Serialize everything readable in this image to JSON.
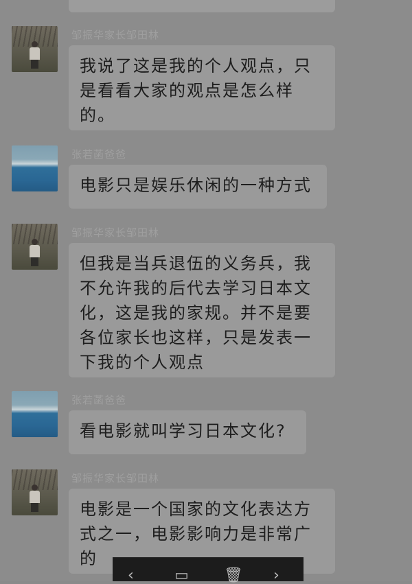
{
  "messages": [
    {
      "sender": "邹振华家长邹田林",
      "lines": [
        "我说了这是我的个人观点，只",
        "是看看大家的观点是怎么样",
        "的。"
      ],
      "avatar": "person-avatar"
    },
    {
      "sender": "张若菡爸爸",
      "lines": [
        "电影只是娱乐休闲的一种方式"
      ],
      "avatar": "lake-avatar"
    },
    {
      "sender": "邹振华家长邹田林",
      "lines": [
        "但我是当兵退伍的义务兵，我",
        "不允许我的后代去学习日本文",
        "化，这是我的家规。并不是要",
        "各位家长也这样，只是发表一",
        "下我的个人观点"
      ],
      "avatar": "person-avatar"
    },
    {
      "sender": "张若菡爸爸",
      "lines": [
        "看电影就叫学习日本文化?"
      ],
      "avatar": "lake-avatar"
    },
    {
      "sender": "邹振华家长邹田林",
      "lines": [
        "电影是一个国家的文化表达方",
        "式之一，电影影响力是非常广",
        "的"
      ],
      "avatar": "person-avatar"
    }
  ],
  "toolbar": {
    "icons": [
      "chevron-left-icon",
      "save-icon",
      "trash-icon",
      "chevron-right-icon"
    ],
    "glyphs": [
      "‹",
      "▭",
      "🗑",
      "›"
    ]
  }
}
